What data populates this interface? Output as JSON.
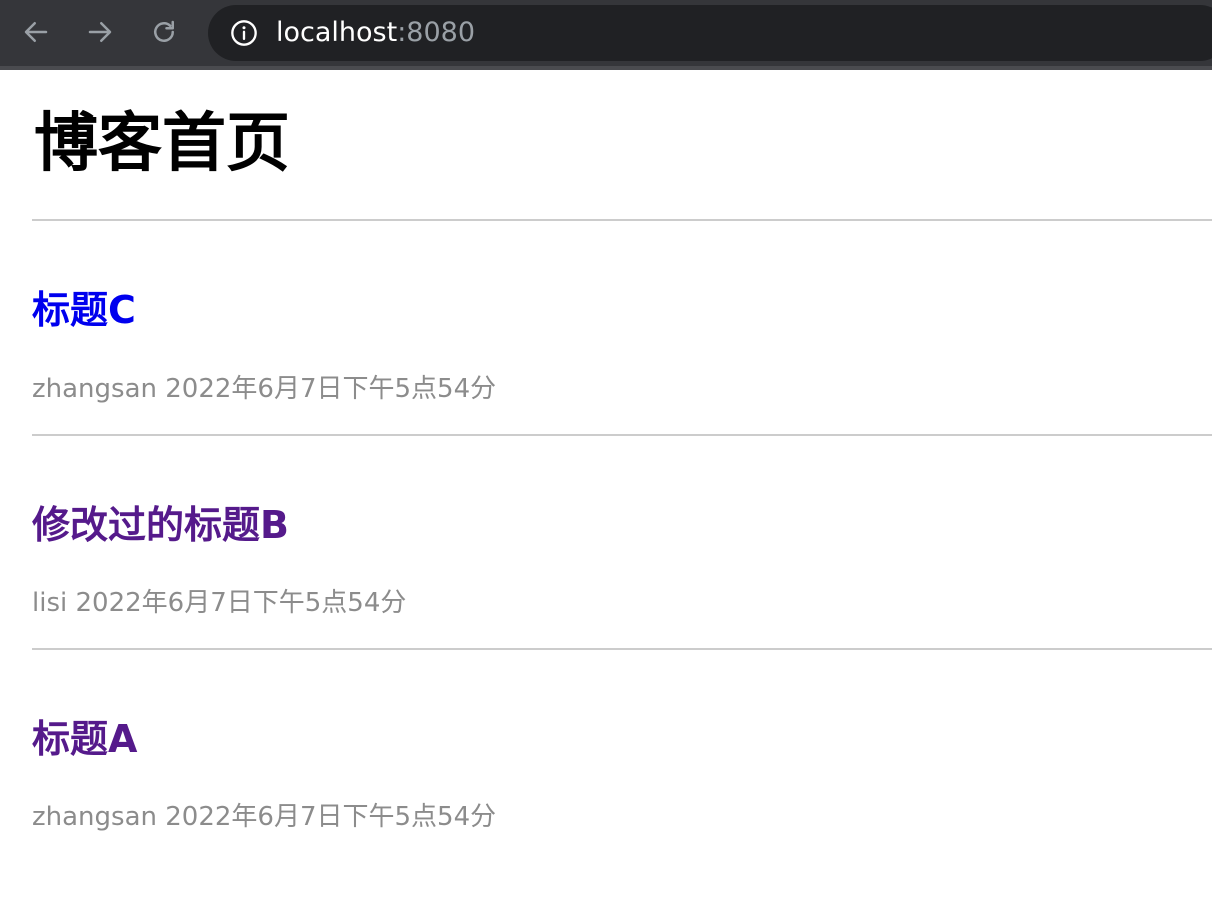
{
  "browser": {
    "url_host": "localhost",
    "url_port": ":8080"
  },
  "page": {
    "title": "博客首页"
  },
  "posts": [
    {
      "title": "标题C",
      "author": "zhangsan",
      "date": "2022年6月7日下午5点54分",
      "link_color": "#0000ee"
    },
    {
      "title": "修改过的标题B",
      "author": "lisi",
      "date": "2022年6月7日下午5点54分",
      "link_color": "#551a8b"
    },
    {
      "title": "标题A",
      "author": "zhangsan",
      "date": "2022年6月7日下午5点54分",
      "link_color": "#551a8b"
    }
  ]
}
